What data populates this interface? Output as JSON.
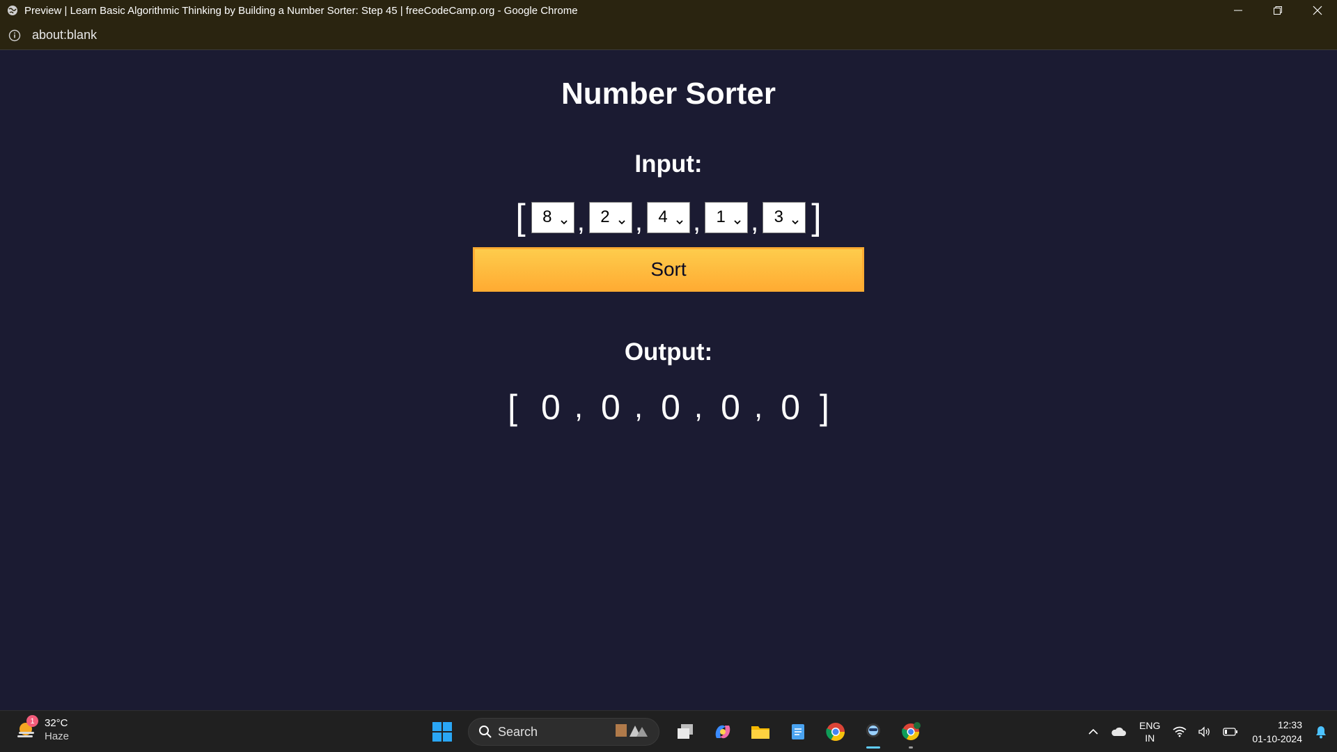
{
  "window": {
    "title": "Preview | Learn Basic Algorithmic Thinking by Building a Number Sorter: Step 45 | freeCodeCamp.org - Google Chrome",
    "address": "about:blank"
  },
  "page": {
    "title": "Number Sorter",
    "input_label": "Input:",
    "output_label": "Output:",
    "open_bracket": "[",
    "close_bracket": "]",
    "comma": ",",
    "inputs": [
      "8",
      "2",
      "4",
      "1",
      "3"
    ],
    "sort_label": "Sort",
    "outputs": [
      "0",
      "0",
      "0",
      "0",
      "0"
    ]
  },
  "taskbar": {
    "weather_temp": "32°C",
    "weather_cond": "Haze",
    "weather_badge": "1",
    "search_label": "Search",
    "lang_line1": "ENG",
    "lang_line2": "IN",
    "time": "12:33",
    "date": "01-10-2024"
  },
  "colors": {
    "page_bg": "#1b1b32",
    "titlebar_bg": "#2a2410",
    "button_top": "#fecc4c",
    "button_bottom": "#ffac33",
    "taskbar_bg": "#202020"
  }
}
